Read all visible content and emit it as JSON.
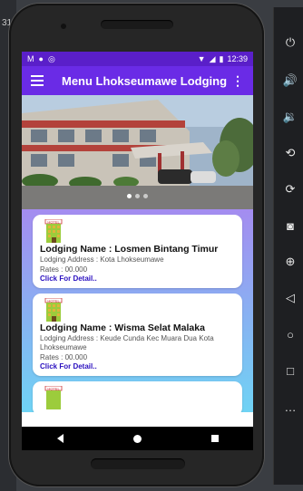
{
  "desktop": {
    "strip_text": "31"
  },
  "statusbar": {
    "left_icons": [
      "M",
      "●",
      "◎"
    ],
    "time": "12:39"
  },
  "toolbar": {
    "title": "Menu Lhokseumawe Lodging",
    "more": "⋮"
  },
  "carousel": {
    "dots": 3,
    "active": 0
  },
  "hotel_icon_text": "HOTEL",
  "cards": [
    {
      "name": "Lodging Name : Losmen Bintang Timur",
      "address": "Lodging Address : Kota Lhokseumawe",
      "rates": "Rates : 00.000",
      "detail": "Click For Detail.."
    },
    {
      "name": "Lodging Name : Wisma Selat Malaka",
      "address": "Lodging Address : Keude Cunda Kec Muara Dua Kota Lhokseumawe",
      "rates": "Rates : 00.000",
      "detail": "Click For Detail.."
    }
  ],
  "side_tools": [
    "power-icon",
    "volume-up-icon",
    "volume-down-icon",
    "rotate-left-icon",
    "rotate-right-icon",
    "camera-icon",
    "zoom-icon",
    "back-icon",
    "home-icon",
    "overview-icon",
    "more-icon"
  ],
  "colors": {
    "toolbar": "#6a2be6",
    "statusbar": "#5a1fc9",
    "link": "#2a0fbf"
  }
}
